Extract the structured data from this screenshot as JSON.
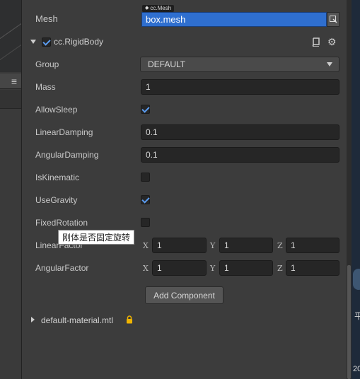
{
  "mesh": {
    "label": "Mesh",
    "asset_type": "cc.Mesh",
    "value": "box.mesh"
  },
  "component": {
    "name": "cc.RigidBody",
    "enabled": true,
    "icons": [
      "book-icon",
      "gear-icon"
    ]
  },
  "properties": {
    "group": {
      "label": "Group",
      "value": "DEFAULT"
    },
    "mass": {
      "label": "Mass",
      "value": "1"
    },
    "allow_sleep": {
      "label": "AllowSleep",
      "checked": true
    },
    "linear_damping": {
      "label": "LinearDamping",
      "value": "0.1"
    },
    "angular_damping": {
      "label": "AngularDamping",
      "value": "0.1"
    },
    "is_kinematic": {
      "label": "IsKinematic",
      "checked": false
    },
    "use_gravity": {
      "label": "UseGravity",
      "checked": true
    },
    "fixed_rotation": {
      "label": "FixedRotation",
      "checked": false
    },
    "linear_factor": {
      "label": "LinearFactor",
      "x": "1",
      "y": "1",
      "z": "1"
    },
    "angular_factor": {
      "label": "AngularFactor",
      "x": "1",
      "y": "1",
      "z": "1"
    }
  },
  "axes": {
    "x": "X",
    "y": "Y",
    "z": "Z"
  },
  "tooltip": "刚体是否固定旋转",
  "add_component_label": "Add Component",
  "material": {
    "name": "default-material.mtl",
    "locked": true
  },
  "right_edge": {
    "t1": "平",
    "t2": "20"
  },
  "colors": {
    "accent": "#2f6fcf",
    "check": "#5b9cf0",
    "lock": "#f0b400"
  }
}
